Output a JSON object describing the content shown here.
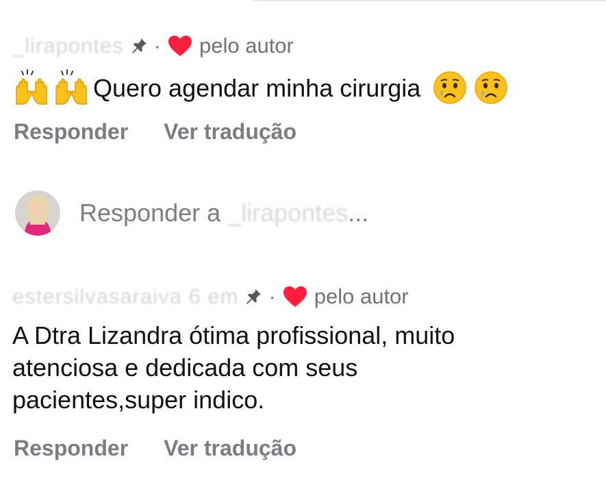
{
  "comments": [
    {
      "username": "_lirapontes",
      "author_badge": "pelo autor",
      "separator": "·",
      "text": "Quero agendar minha cirurgia",
      "actions": {
        "reply": "Responder",
        "translate": "Ver tradução"
      },
      "emoji_before": [
        "raising-hands-emoji",
        "raising-hands-emoji"
      ],
      "emoji_after": [
        "crying-face-emoji",
        "crying-face-emoji"
      ]
    },
    {
      "username": "estersilvasaraiva 6    em",
      "author_badge": "pelo autor",
      "separator": "·",
      "text_lines": [
        "A Dtra Lizandra ótima profissional, muito",
        "atenciosa e dedicada com seus",
        "pacientes,super indico."
      ],
      "actions": {
        "reply": "Responder",
        "translate": "Ver tradução"
      }
    }
  ],
  "reply_box": {
    "placeholder": "Responder a",
    "target": "_lirapontes",
    "ellipsis": "..."
  },
  "colors": {
    "heart": "#ff1f3d",
    "muted_text": "#7a7d82",
    "main_text": "#111111"
  }
}
